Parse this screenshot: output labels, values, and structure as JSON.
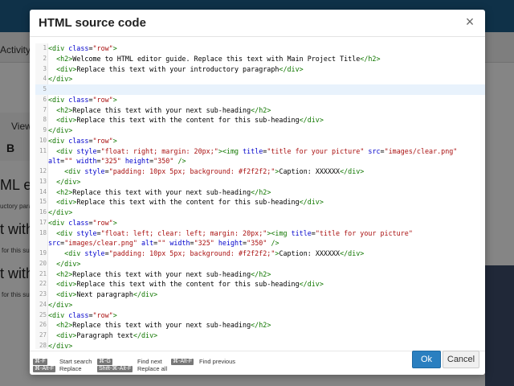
{
  "background": {
    "menu_activity": "Activity",
    "toolbar_view": "View",
    "toolbar_bold": "B",
    "heading_fragment": "ML ed",
    "intro_fragment": "uctory para",
    "subheading_fragment": "t with",
    "content_fragment": "for this su"
  },
  "dialog": {
    "title": "HTML source code",
    "close_glyph": "×",
    "ok_label": "Ok",
    "cancel_label": "Cancel"
  },
  "shortcuts": [
    {
      "key": "⌘-F",
      "label": "Start search"
    },
    {
      "key": "⌘-G",
      "label": "Find next"
    },
    {
      "key": "⌘-Alt-F",
      "label": "Find previous"
    },
    {
      "key": "⌘-Alt-F",
      "label": "Replace"
    },
    {
      "key": "Shift-⌘-Alt-F",
      "label": "Replace all"
    }
  ],
  "code_lines": [
    {
      "n": "1",
      "text": "<div class=\"row\">"
    },
    {
      "n": "2",
      "text": "  <h2>Welcome to HTML editor guide. Replace this text with Main Project Title</h2>"
    },
    {
      "n": "3",
      "text": "  <div>Replace this text with your introductory paragraph</div>"
    },
    {
      "n": "4",
      "text": "</div>"
    },
    {
      "n": "5",
      "text": ""
    },
    {
      "n": "6",
      "text": "<div class=\"row\">"
    },
    {
      "n": "7",
      "text": "  <h2>Replace this text with your next sub-heading</h2>"
    },
    {
      "n": "8",
      "text": "  <div>Replace this text with the content for this sub-heading</div>"
    },
    {
      "n": "9",
      "text": "</div>"
    },
    {
      "n": "10",
      "text": "<div class=\"row\">"
    },
    {
      "n": "11",
      "text": "  <div style=\"float: right; margin: 20px;\"><img title=\"title for your picture\" src=\"images/clear.png\"\nalt=\"\" width=\"325\" height=\"350\" />"
    },
    {
      "n": "12",
      "text": "    <div style=\"padding: 10px 5px; background: #f2f2f2;\">Caption: XXXXXX</div>"
    },
    {
      "n": "13",
      "text": "  </div>"
    },
    {
      "n": "14",
      "text": "  <h2>Replace this text with your next sub-heading</h2>"
    },
    {
      "n": "15",
      "text": "  <div>Replace this text with the content for this sub-heading</div>"
    },
    {
      "n": "16",
      "text": "</div>"
    },
    {
      "n": "17",
      "text": "<div class=\"row\">"
    },
    {
      "n": "18",
      "text": "  <div style=\"float: left; clear: left; margin: 20px;\"><img title=\"title for your picture\"\nsrc=\"images/clear.png\" alt=\"\" width=\"325\" height=\"350\" />"
    },
    {
      "n": "19",
      "text": "    <div style=\"padding: 10px 5px; background: #f2f2f2;\">Caption: XXXXXX</div>"
    },
    {
      "n": "20",
      "text": "  </div>"
    },
    {
      "n": "21",
      "text": "  <h2>Replace this text with your next sub-heading</h2>"
    },
    {
      "n": "22",
      "text": "  <div>Replace this text with the content for this sub-heading</div>"
    },
    {
      "n": "23",
      "text": "  <div>Next paragraph</div>"
    },
    {
      "n": "24",
      "text": "</div>"
    },
    {
      "n": "25",
      "text": "<div class=\"row\">"
    },
    {
      "n": "26",
      "text": "  <h2>Replace this text with your next sub-heading</h2>"
    },
    {
      "n": "27",
      "text": "  <div>Paragraph text</div>"
    },
    {
      "n": "28",
      "text": "</div>"
    }
  ],
  "active_line": "5",
  "colors": {
    "tag": "#117700",
    "attr": "#0000cc",
    "string": "#aa1111",
    "ok_button": "#2a7fc0"
  }
}
